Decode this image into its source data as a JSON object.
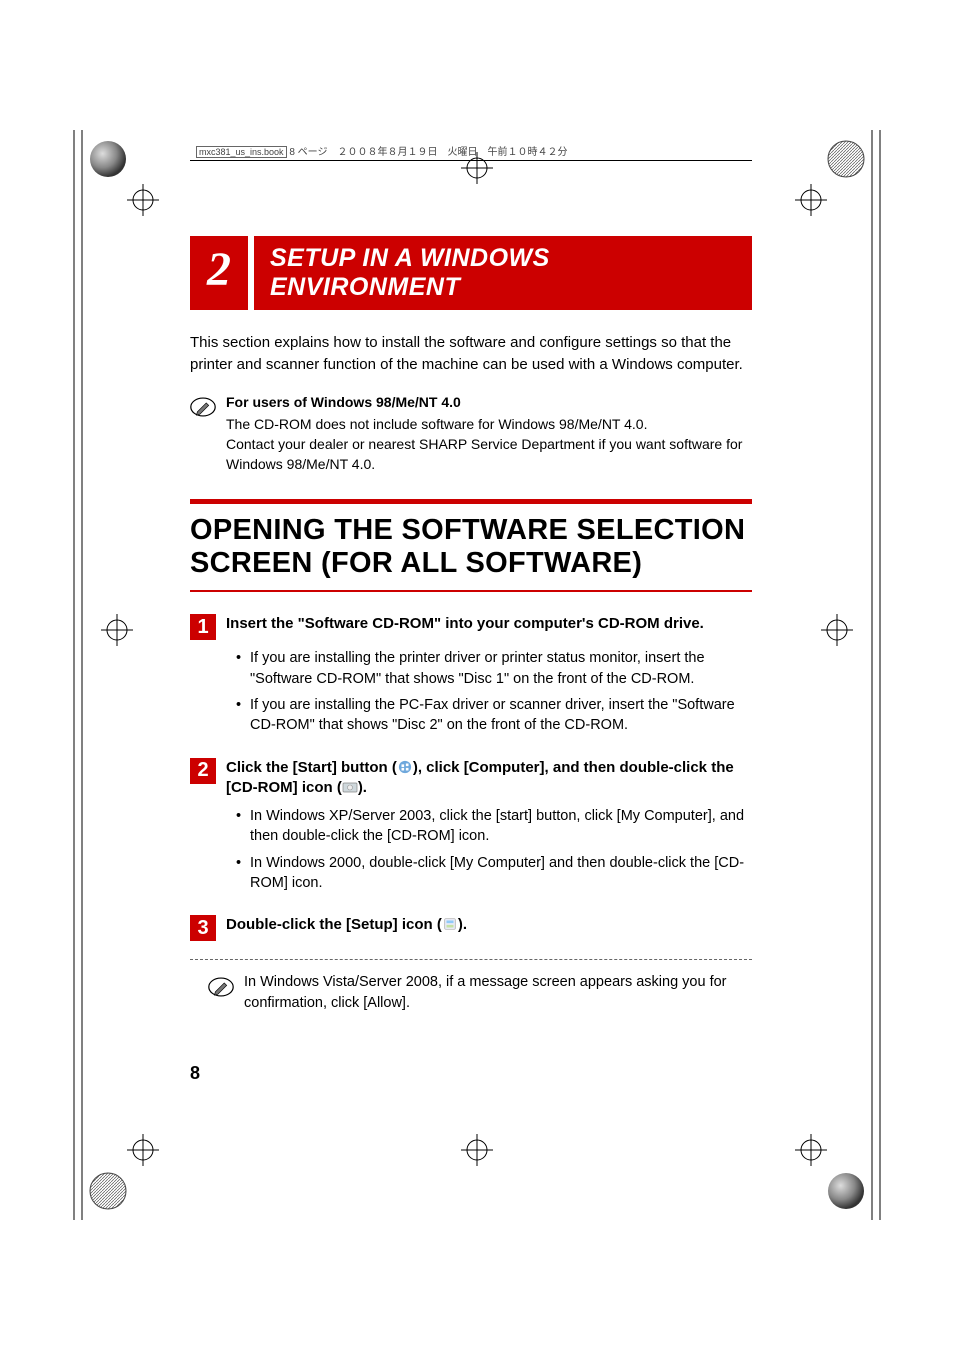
{
  "header": {
    "filename": "mxc381_us_ins.book",
    "meta": "8 ページ　２００８年８月１９日　火曜日　午前１０時４２分"
  },
  "chapter": {
    "number": "2",
    "title": "SETUP IN A WINDOWS ENVIRONMENT"
  },
  "intro": "This section explains how to install the software and configure settings so that the printer and scanner function of the machine can be used with a Windows computer.",
  "note1": {
    "title": "For users of Windows 98/Me/NT 4.0",
    "line1": "The CD-ROM does not include software for Windows 98/Me/NT 4.0.",
    "line2": "Contact your dealer or nearest SHARP Service Department if you want software for Windows 98/Me/NT 4.0."
  },
  "section_title": "OPENING THE SOFTWARE SELECTION SCREEN (FOR ALL SOFTWARE)",
  "steps": {
    "s1": {
      "num": "1",
      "heading": "Insert the \"Software CD-ROM\" into your computer's CD-ROM drive.",
      "b1": "If you are installing the printer driver or printer status monitor, insert the \"Software CD-ROM\" that shows \"Disc 1\" on the front of the CD-ROM.",
      "b2": "If you are installing the PC-Fax driver or scanner driver, insert the \"Software CD-ROM\" that shows \"Disc 2\" on the front of the CD-ROM."
    },
    "s2": {
      "num": "2",
      "heading_a": "Click the [Start] button (",
      "heading_b": "), click [Computer], and then double-click the [CD-ROM] icon (",
      "heading_c": ").",
      "b1": "In Windows XP/Server 2003, click the [start] button, click [My Computer], and then double-click the [CD-ROM] icon.",
      "b2": "In Windows 2000, double-click [My Computer] and then double-click the [CD-ROM] icon."
    },
    "s3": {
      "num": "3",
      "heading_a": "Double-click the [Setup] icon (",
      "heading_b": ")."
    }
  },
  "note2": "In Windows Vista/Server 2008, if a message screen appears asking you for confirmation, click [Allow].",
  "page_number": "8"
}
